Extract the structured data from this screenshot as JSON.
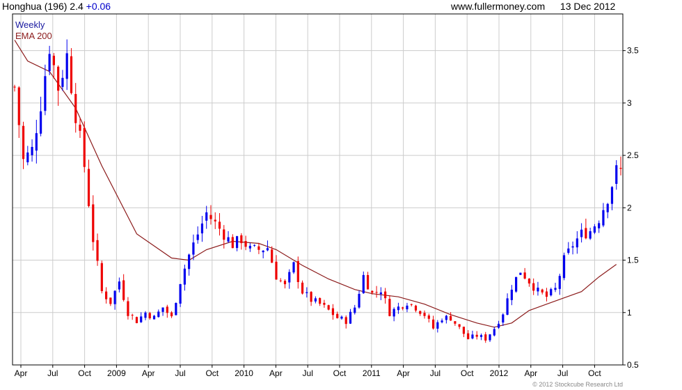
{
  "header": {
    "symbol": "Honghua (196)",
    "price": "2.4",
    "change": "+0.06",
    "source": "www.fullermoney.com",
    "date": "13 Dec 2012"
  },
  "copyright": "© 2012 Stockcube Research Ltd",
  "colors": {
    "up": "#0000ee",
    "down": "#ee0000",
    "ema": "#8b1a1a",
    "grid": "#cccccc",
    "change": "#0000cc",
    "legend_weekly": "#1a1aa0"
  },
  "chart_data": {
    "type": "candlestick",
    "interval": "Weekly",
    "legend": [
      "Weekly",
      "EMA 200"
    ],
    "legend_position": "top-left",
    "grid": true,
    "ylim": [
      0.5,
      3.85
    ],
    "yticks": [
      "0.5",
      "1",
      "1.5",
      "2",
      "2.5",
      "3",
      "3.5"
    ],
    "xticks": [
      "Apr",
      "Jul",
      "Oct",
      "2009",
      "Apr",
      "Jul",
      "Oct",
      "2010",
      "Apr",
      "Jul",
      "Oct",
      "2011",
      "Apr",
      "Jul",
      "Oct",
      "2012",
      "Apr",
      "Jul",
      "Oct"
    ],
    "close_path": [
      [
        0,
        3.15
      ],
      [
        2,
        2.45
      ],
      [
        4,
        2.55
      ],
      [
        6,
        3.0
      ],
      [
        8,
        3.55
      ],
      [
        10,
        3.15
      ],
      [
        12,
        3.45
      ],
      [
        14,
        2.9
      ],
      [
        16,
        2.4
      ],
      [
        18,
        1.7
      ],
      [
        20,
        1.2
      ],
      [
        22,
        1.1
      ],
      [
        24,
        1.3
      ],
      [
        26,
        1.0
      ],
      [
        28,
        0.92
      ],
      [
        30,
        1.0
      ],
      [
        32,
        0.95
      ],
      [
        34,
        1.05
      ],
      [
        36,
        0.95
      ],
      [
        38,
        1.3
      ],
      [
        40,
        1.55
      ],
      [
        42,
        1.75
      ],
      [
        44,
        1.95
      ],
      [
        46,
        1.85
      ],
      [
        48,
        1.75
      ],
      [
        50,
        1.65
      ],
      [
        52,
        1.7
      ],
      [
        54,
        1.6
      ],
      [
        56,
        1.6
      ],
      [
        58,
        1.62
      ],
      [
        60,
        1.35
      ],
      [
        62,
        1.25
      ],
      [
        64,
        1.45
      ],
      [
        66,
        1.2
      ],
      [
        68,
        1.12
      ],
      [
        70,
        1.08
      ],
      [
        72,
        1.02
      ],
      [
        74,
        0.95
      ],
      [
        76,
        0.92
      ],
      [
        78,
        1.05
      ],
      [
        80,
        1.35
      ],
      [
        82,
        1.18
      ],
      [
        84,
        1.22
      ],
      [
        86,
        1.0
      ],
      [
        88,
        1.05
      ],
      [
        90,
        1.1
      ],
      [
        92,
        1.05
      ],
      [
        94,
        0.98
      ],
      [
        96,
        0.85
      ],
      [
        98,
        0.95
      ],
      [
        100,
        0.95
      ],
      [
        102,
        0.85
      ],
      [
        104,
        0.75
      ],
      [
        106,
        0.78
      ],
      [
        108,
        0.75
      ],
      [
        110,
        0.85
      ],
      [
        112,
        1.0
      ],
      [
        114,
        1.25
      ],
      [
        116,
        1.4
      ],
      [
        118,
        1.3
      ],
      [
        120,
        1.2
      ],
      [
        122,
        1.15
      ],
      [
        124,
        1.22
      ],
      [
        126,
        1.5
      ],
      [
        128,
        1.65
      ],
      [
        130,
        1.75
      ],
      [
        132,
        1.78
      ],
      [
        134,
        1.9
      ],
      [
        136,
        2.1
      ],
      [
        138,
        2.35
      ]
    ],
    "ema_200": [
      [
        0,
        3.6
      ],
      [
        3,
        3.4
      ],
      [
        8,
        3.3
      ],
      [
        14,
        2.95
      ],
      [
        20,
        2.4
      ],
      [
        28,
        1.75
      ],
      [
        36,
        1.52
      ],
      [
        40,
        1.5
      ],
      [
        44,
        1.6
      ],
      [
        50,
        1.68
      ],
      [
        56,
        1.66
      ],
      [
        60,
        1.6
      ],
      [
        66,
        1.45
      ],
      [
        72,
        1.32
      ],
      [
        78,
        1.22
      ],
      [
        82,
        1.18
      ],
      [
        88,
        1.15
      ],
      [
        94,
        1.08
      ],
      [
        100,
        0.98
      ],
      [
        106,
        0.9
      ],
      [
        110,
        0.86
      ],
      [
        114,
        0.9
      ],
      [
        118,
        1.02
      ],
      [
        122,
        1.08
      ],
      [
        126,
        1.14
      ],
      [
        130,
        1.2
      ],
      [
        134,
        1.34
      ],
      [
        138,
        1.46
      ]
    ]
  }
}
